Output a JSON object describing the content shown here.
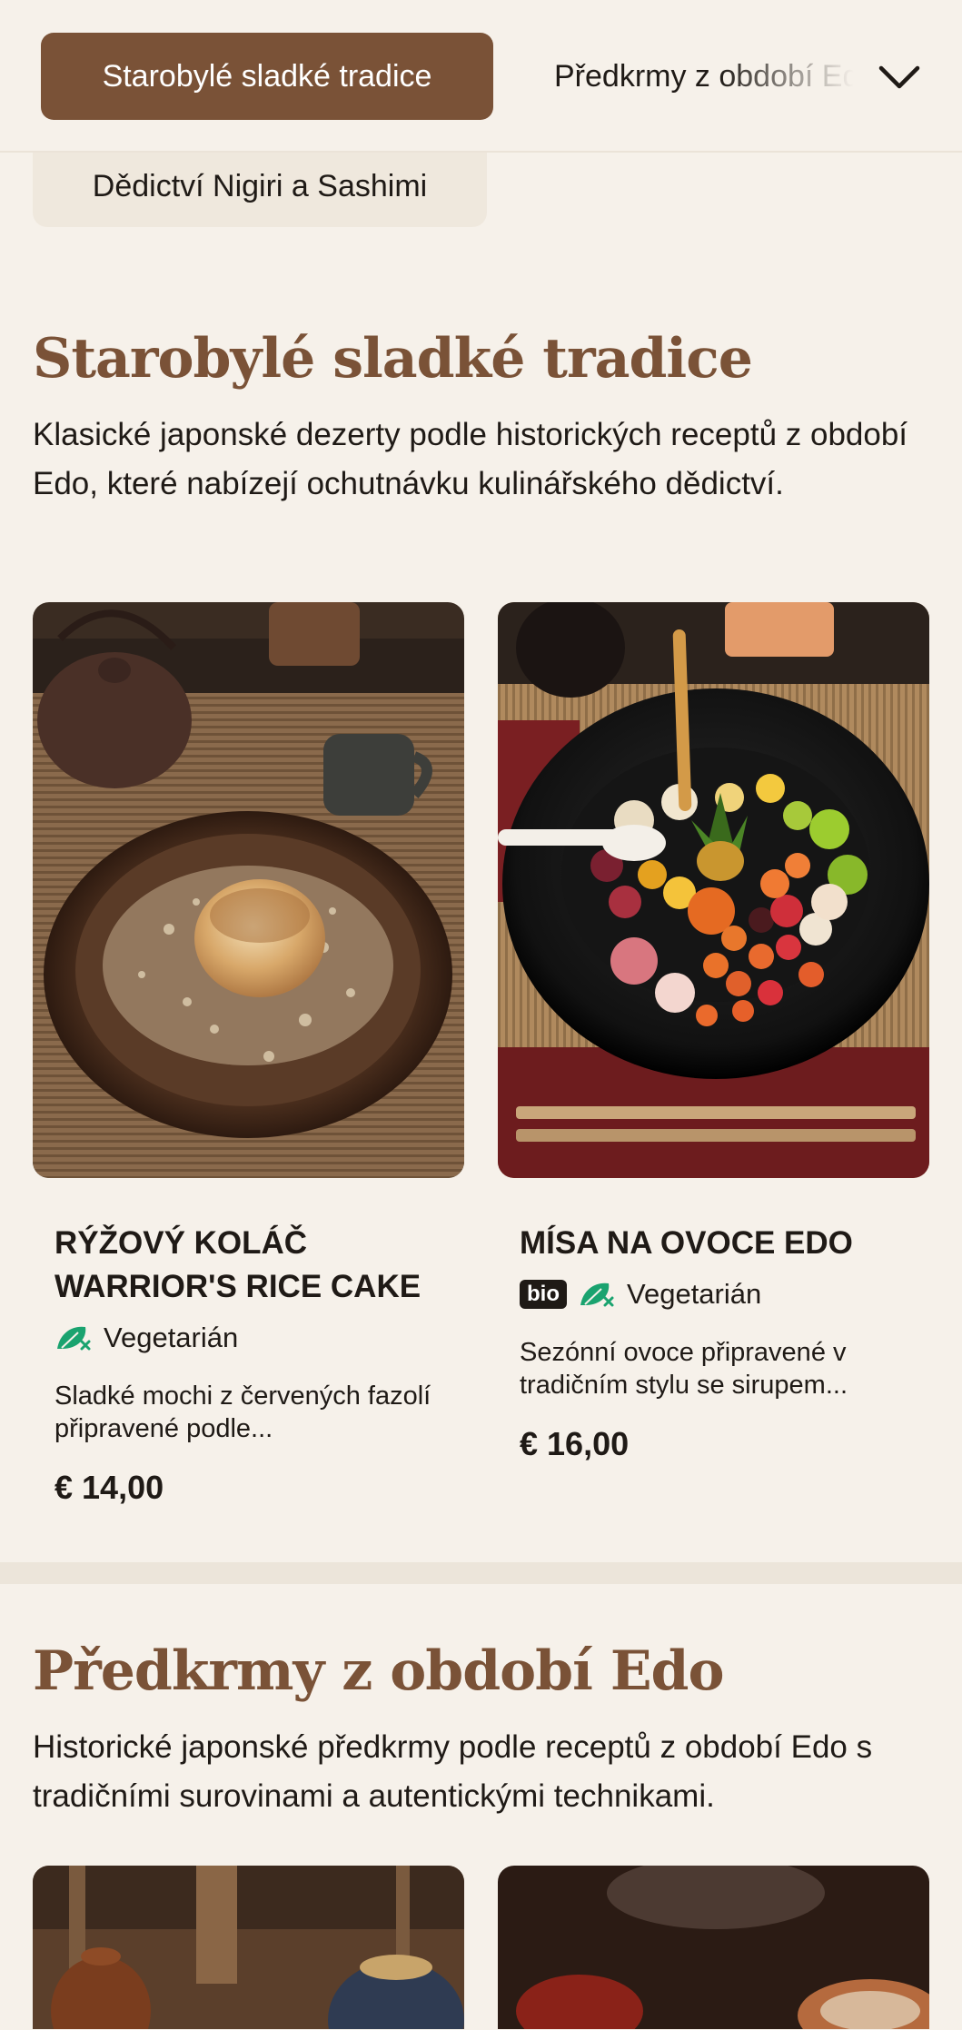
{
  "category_bar": {
    "active_chip": "Starobylé sladké tradice",
    "next_chip": "Předkrmy z období Edo",
    "second_row_chip": "Dědictví Nigiri a Sashimi",
    "expand_icon": "chevron-down-icon"
  },
  "sections": [
    {
      "title": "Starobylé sladké tradice",
      "description": "Klasické japonské dezerty podle historických receptů z období Edo, které nabízejí ochutnávku kulinářského dědictví.",
      "items": [
        {
          "title": "RÝŽOVÝ KOLÁČ WARRIOR'S RICE CAKE",
          "bio": "",
          "diet": "Vegetarián",
          "description": "Sladké mochi z červených fazolí připravené podle...",
          "price": "€ 14,00",
          "image": "mochi-dessert-photo"
        },
        {
          "title": "MÍSA NA OVOCE EDO",
          "bio": "bio",
          "diet": "Vegetarián",
          "description": "Sezónní ovoce připravené v tradičním stylu se sirupem...",
          "price": "€ 16,00",
          "image": "fruit-bowl-photo"
        }
      ]
    },
    {
      "title": "Předkrmy z období Edo",
      "description": "Historické japonské předkrmy podle receptů z období Edo s tradičními surovinami a autentickými technikami.",
      "items": [
        {
          "image": "clay-pot-table-photo"
        },
        {
          "image": "steaming-dish-photo"
        }
      ]
    }
  ],
  "colors": {
    "brand": "#7a5237",
    "background": "#f6f1ea",
    "veg_green": "#1aa36f"
  }
}
